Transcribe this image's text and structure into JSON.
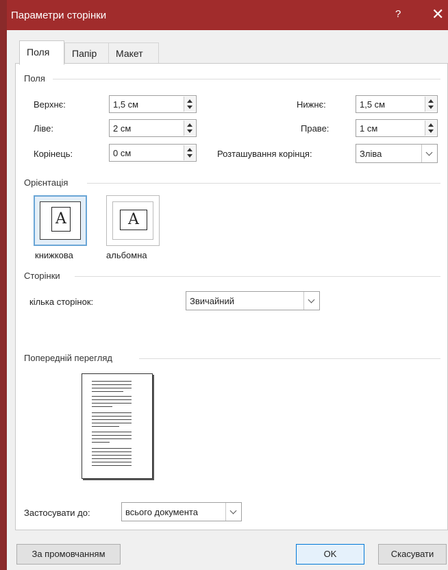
{
  "window": {
    "title": "Параметри сторінки",
    "help_label": "?",
    "close_label": "✕"
  },
  "tabs": [
    {
      "label": "Поля"
    },
    {
      "label": "Папір"
    },
    {
      "label": "Макет"
    }
  ],
  "margins": {
    "group_label": "Поля",
    "top_label": "Верхнє:",
    "top_value": "1,5 см",
    "bottom_label": "Нижнє:",
    "bottom_value": "1,5 см",
    "left_label": "Ліве:",
    "left_value": "2 см",
    "right_label": "Праве:",
    "right_value": "1 см",
    "gutter_label": "Корінець:",
    "gutter_value": "0 см",
    "gutter_pos_label": "Розташування корінця:",
    "gutter_pos_value": "Зліва"
  },
  "orientation": {
    "group_label": "Орієнтація",
    "portrait_label": "книжкова",
    "landscape_label": "альбомна",
    "icon_letter": "A",
    "selected": "portrait"
  },
  "pages": {
    "group_label": "Сторінки",
    "multiple_label": "кілька сторінок:",
    "multiple_value": "Звичайний"
  },
  "preview": {
    "group_label": "Попередній перегляд"
  },
  "apply": {
    "label": "Застосувати до:",
    "value": "всього документа"
  },
  "buttons": {
    "default_label": "За промовчанням",
    "ok_label": "OK",
    "cancel_label": "Скасувати"
  }
}
